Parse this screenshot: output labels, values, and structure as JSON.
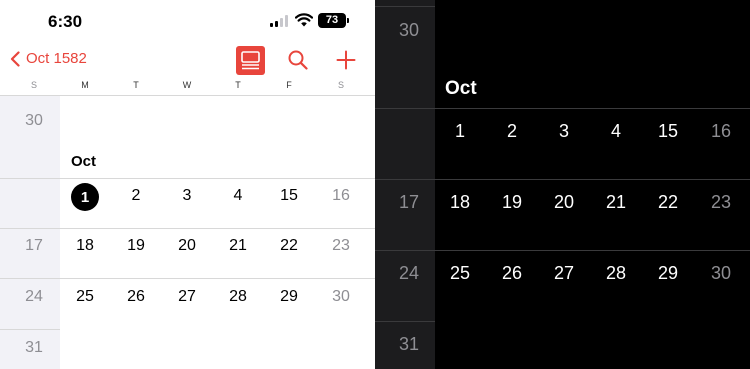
{
  "status": {
    "time": "6:30",
    "battery": "73"
  },
  "nav": {
    "back_label": "Oct 1582"
  },
  "weekdays": [
    "S",
    "M",
    "T",
    "W",
    "T",
    "F",
    "S"
  ],
  "light": {
    "month": "Oct",
    "prev_week_last": "30",
    "rows": [
      [
        "1",
        "2",
        "3",
        "4",
        "15",
        "16"
      ],
      [
        "17",
        "18",
        "19",
        "20",
        "21",
        "22",
        "23"
      ],
      [
        "24",
        "25",
        "26",
        "27",
        "28",
        "29",
        "30"
      ],
      [
        "31"
      ]
    ]
  },
  "dark": {
    "month": "Oct",
    "prev_week_last": "30",
    "rows": [
      [
        "1",
        "2",
        "3",
        "4",
        "15",
        "16"
      ],
      [
        "17",
        "18",
        "19",
        "20",
        "21",
        "22",
        "23"
      ],
      [
        "24",
        "25",
        "26",
        "27",
        "28",
        "29",
        "30"
      ],
      [
        "31"
      ]
    ]
  },
  "colors": {
    "accent": "#e8453c",
    "muted": "#8e8e93"
  }
}
